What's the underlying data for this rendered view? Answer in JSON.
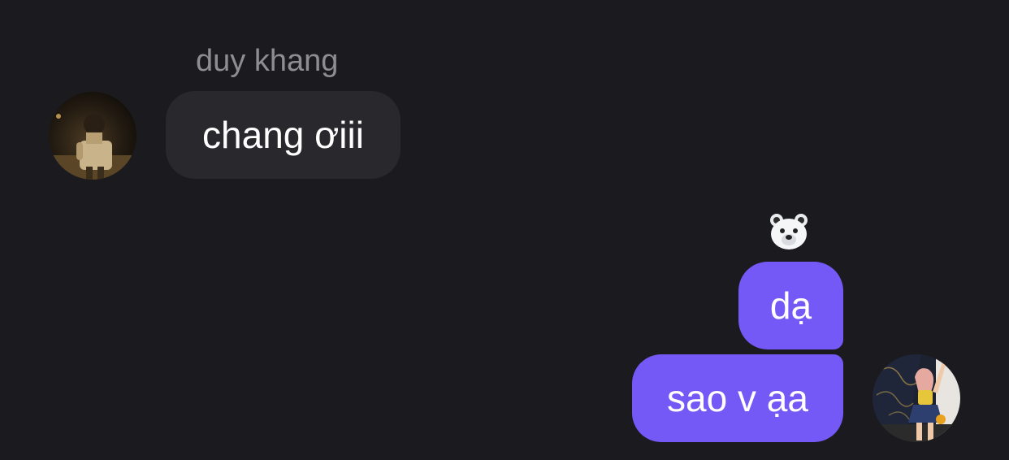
{
  "conversation": {
    "incoming": {
      "sender_name": "duy khang",
      "avatar_icon": "user-avatar-photo",
      "messages": [
        {
          "text": "chang ơiii"
        }
      ]
    },
    "outgoing": {
      "avatar_icon": "user-avatar-photo",
      "reaction_icon": "polar-bear-emoji",
      "messages": [
        {
          "text": "dạ"
        },
        {
          "text": "sao v ạa"
        }
      ]
    }
  },
  "colors": {
    "background": "#1b1a1f",
    "incoming_bubble": "#29282d",
    "outgoing_bubble": "#7459f6",
    "sender_name": "#8e8d93",
    "message_text": "#ffffff"
  }
}
